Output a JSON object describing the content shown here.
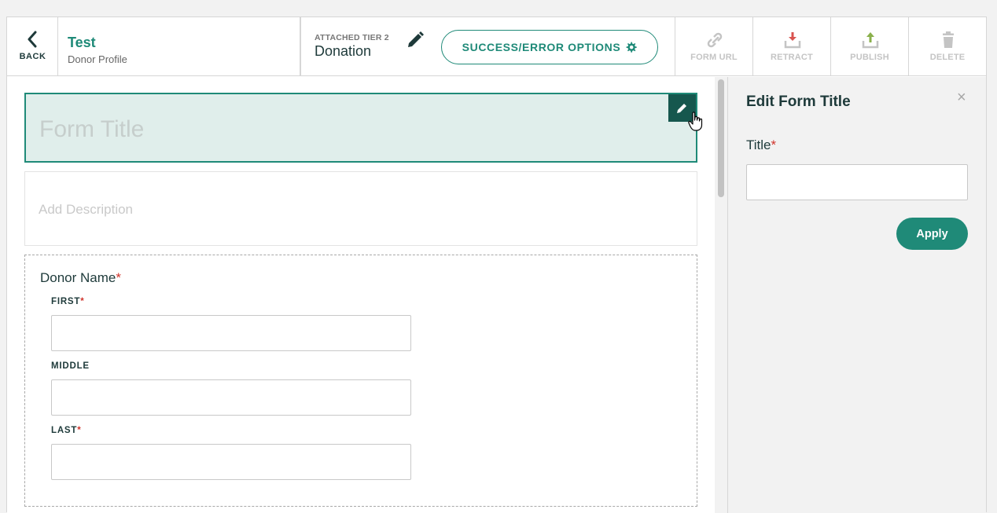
{
  "header": {
    "back_label": "BACK",
    "title": "Test",
    "subtitle": "Donor Profile",
    "tier_label": "ATTACHED TIER 2",
    "tier_value": "Donation",
    "success_error_label": "SUCCESS/ERROR OPTIONS",
    "actions": [
      {
        "label": "FORM URL",
        "icon": "link-icon"
      },
      {
        "label": "RETRACT",
        "icon": "download-tray-icon"
      },
      {
        "label": "PUBLISH",
        "icon": "upload-tray-icon"
      },
      {
        "label": "DELETE",
        "icon": "trash-icon"
      }
    ]
  },
  "form": {
    "title_placeholder": "Form Title",
    "description_placeholder": "Add Description",
    "donor_name": {
      "label": "Donor Name",
      "required": "*",
      "fields": [
        {
          "label": "FIRST",
          "required": "*",
          "value": ""
        },
        {
          "label": "MIDDLE",
          "required": "",
          "value": ""
        },
        {
          "label": "LAST",
          "required": "*",
          "value": ""
        }
      ]
    }
  },
  "panel": {
    "heading": "Edit Form Title",
    "close": "×",
    "title_label": "Title",
    "title_required": "*",
    "title_value": "",
    "apply_label": "Apply"
  },
  "colors": {
    "accent": "#1f8a78",
    "accent_dark": "#16574e",
    "title_bg": "#e0eeeb",
    "required": "#d0342c",
    "retract_icon": "#d9534f",
    "publish_icon": "#8ab04b"
  }
}
